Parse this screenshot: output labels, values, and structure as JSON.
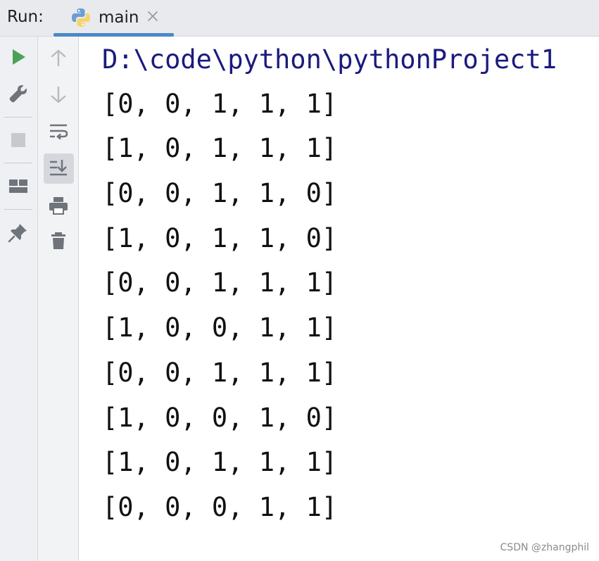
{
  "header": {
    "run_label": "Run:",
    "tab_name": "main",
    "tab_icon": "python-icon"
  },
  "toolbar_left": [
    {
      "name": "rerun-icon",
      "color": "#4aa25a"
    },
    {
      "name": "wrench-icon"
    },
    {
      "name": "stop-icon"
    },
    {
      "name": "layout-icon"
    },
    {
      "name": "pin-icon"
    }
  ],
  "toolbar_right": [
    {
      "name": "up-arrow-icon"
    },
    {
      "name": "down-arrow-icon"
    },
    {
      "name": "soft-wrap-icon"
    },
    {
      "name": "scroll-to-end-icon",
      "active": true
    },
    {
      "name": "print-icon"
    },
    {
      "name": "trash-icon"
    }
  ],
  "console": {
    "path_line": "D:\\code\\python\\pythonProject1",
    "lines": [
      "[0, 0, 1, 1, 1]",
      "[1, 0, 1, 1, 1]",
      "[0, 0, 1, 1, 0]",
      "[1, 0, 1, 1, 0]",
      "[0, 0, 1, 1, 1]",
      "[1, 0, 0, 1, 1]",
      "[0, 0, 1, 1, 1]",
      "[1, 0, 0, 1, 0]",
      "[1, 0, 1, 1, 1]",
      "[0, 0, 0, 1, 1]"
    ]
  },
  "watermark": "CSDN @zhangphil",
  "colors": {
    "accent": "#4a88c7",
    "path_text": "#1a1a7e",
    "run_green": "#4aa25a"
  }
}
